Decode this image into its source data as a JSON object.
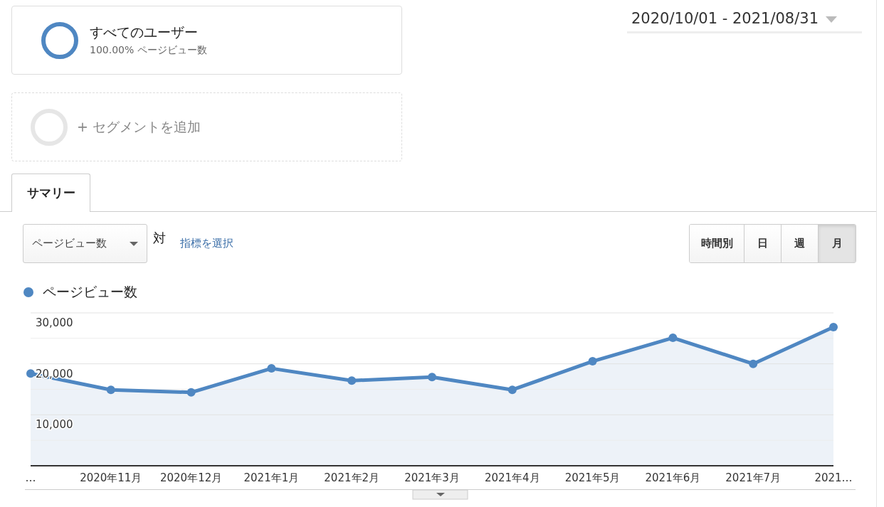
{
  "segments": [
    {
      "kind": "active",
      "name": "すべてのユーザー",
      "detail": "100.00% ページビュー数"
    },
    {
      "kind": "add",
      "name": "+ セグメントを追加"
    }
  ],
  "date_range": {
    "value": "2020/10/01 - 2021/08/31"
  },
  "tabs": [
    {
      "label": "サマリー",
      "selected": true
    }
  ],
  "metric_select": {
    "value": "ページビュー数"
  },
  "versus": "対",
  "select_metric_link": "指標を選択",
  "granularity": [
    {
      "label": "時間別",
      "selected": false
    },
    {
      "label": "日",
      "selected": false
    },
    {
      "label": "週",
      "selected": false
    },
    {
      "label": "月",
      "selected": true
    }
  ],
  "chart": {
    "chart_data": {
      "type": "area",
      "categories": [
        "…",
        "2020年11月",
        "2020年12月",
        "2021年1月",
        "2021年2月",
        "2021年3月",
        "2021年4月",
        "2021年5月",
        "2021年6月",
        "2021年7月",
        "2021…"
      ],
      "series": [
        {
          "name": "ページビュー数",
          "color": "#4f87c2",
          "values": [
            18100,
            14900,
            14400,
            19100,
            16700,
            17400,
            14900,
            20500,
            25100,
            20000,
            27200
          ]
        }
      ],
      "ylim": [
        0,
        30000
      ],
      "yticks": [
        {
          "value": 10000,
          "label": "10,000"
        },
        {
          "value": 20000,
          "label": "20,000"
        },
        {
          "value": 30000,
          "label": "30,000"
        }
      ]
    }
  }
}
